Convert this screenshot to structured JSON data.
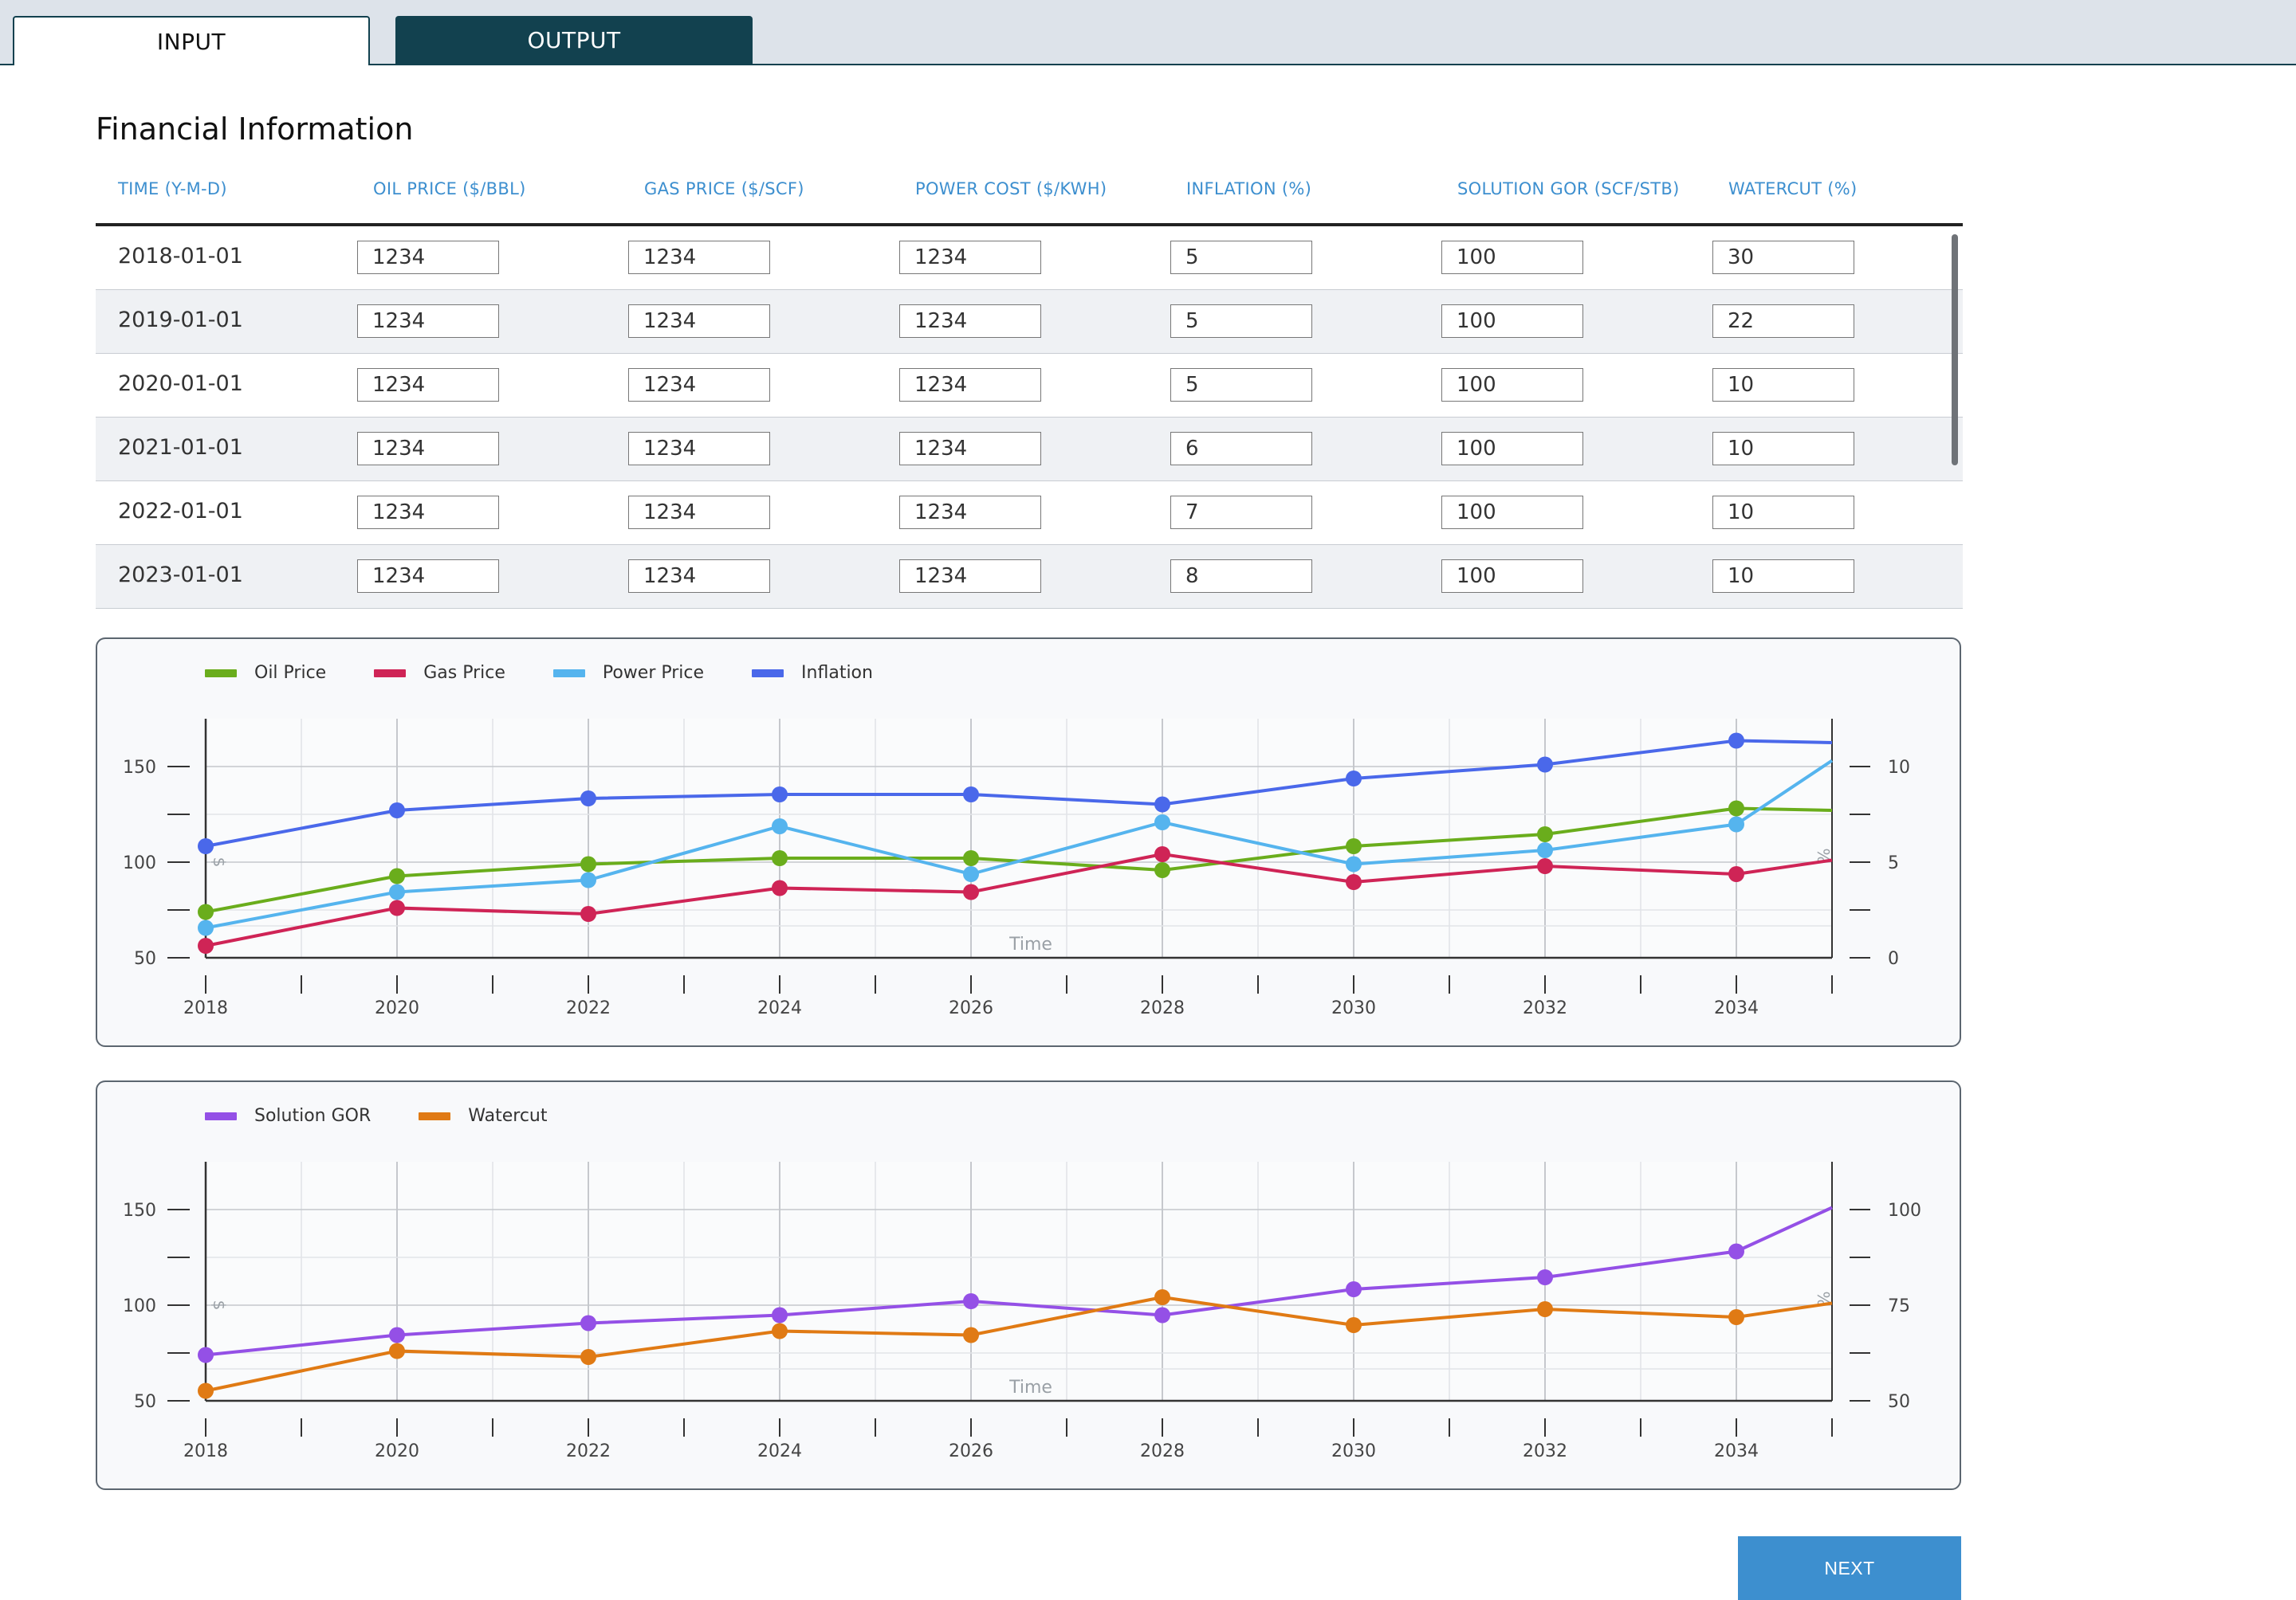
{
  "tabs": {
    "input_label": "INPUT",
    "output_label": "OUTPUT"
  },
  "page_title": "Financial Information",
  "table": {
    "headers": [
      "TIME (Y-M-D)",
      "OIL PRICE ($/BBL)",
      "GAS PRICE ($/SCF)",
      "POWER COST ($/KWH)",
      "INFLATION (%)",
      "SOLUTION GOR (SCF/STB)",
      "WATERCUT (%)"
    ],
    "rows": [
      {
        "date": "2018-01-01",
        "oil": "1234",
        "gas": "1234",
        "power": "1234",
        "inflation": "5",
        "gor": "100",
        "watercut": "30"
      },
      {
        "date": "2019-01-01",
        "oil": "1234",
        "gas": "1234",
        "power": "1234",
        "inflation": "5",
        "gor": "100",
        "watercut": "22"
      },
      {
        "date": "2020-01-01",
        "oil": "1234",
        "gas": "1234",
        "power": "1234",
        "inflation": "5",
        "gor": "100",
        "watercut": "10"
      },
      {
        "date": "2021-01-01",
        "oil": "1234",
        "gas": "1234",
        "power": "1234",
        "inflation": "6",
        "gor": "100",
        "watercut": "10"
      },
      {
        "date": "2022-01-01",
        "oil": "1234",
        "gas": "1234",
        "power": "1234",
        "inflation": "7",
        "gor": "100",
        "watercut": "10"
      },
      {
        "date": "2023-01-01",
        "oil": "1234",
        "gas": "1234",
        "power": "1234",
        "inflation": "8",
        "gor": "100",
        "watercut": "10"
      }
    ]
  },
  "chart_data": [
    {
      "type": "line",
      "xlabel": "Time",
      "ylabel_left": "$",
      "ylabel_right": "%",
      "x": [
        2018,
        2020,
        2022,
        2024,
        2026,
        2028,
        2030,
        2032,
        2034
      ],
      "x_tick_labels": [
        "2018",
        "2020",
        "2022",
        "2024",
        "2026",
        "2028",
        "2030",
        "2032",
        "2034"
      ],
      "xlim": [
        2018,
        2035
      ],
      "ylim_left": [
        50,
        170
      ],
      "ylim_right": [
        0,
        12
      ],
      "yticks_left": [
        "150",
        "100",
        "50"
      ],
      "yticks_right": [
        "10",
        "5",
        "0"
      ],
      "grid": true,
      "legend_position": "top-left",
      "series": [
        {
          "name": "Oil Price",
          "color": "#6aad1c",
          "axis": "left",
          "values": [
            73,
            91,
            97,
            100,
            100,
            94,
            106,
            112,
            125
          ],
          "end_value": 124
        },
        {
          "name": "Gas Price",
          "color": "#cf2456",
          "axis": "left",
          "values": [
            56,
            75,
            72,
            85,
            83,
            102,
            88,
            96,
            92
          ],
          "end_value": 99
        },
        {
          "name": "Power Price",
          "color": "#55b4ee",
          "axis": "left",
          "values": [
            65,
            83,
            89,
            116,
            92,
            118,
            97,
            104,
            117
          ],
          "end_value": 149
        },
        {
          "name": "Inflation",
          "color": "#4a68ea",
          "axis": "right",
          "values": [
            5.6,
            7.4,
            8.0,
            8.2,
            8.2,
            7.7,
            9.0,
            9.7,
            10.9
          ],
          "end_value": 10.8
        }
      ]
    },
    {
      "type": "line",
      "xlabel": "Time",
      "ylabel_left": "$",
      "ylabel_right": "%",
      "x": [
        2018,
        2020,
        2022,
        2024,
        2026,
        2028,
        2030,
        2032,
        2034
      ],
      "x_tick_labels": [
        "2018",
        "2020",
        "2022",
        "2024",
        "2026",
        "2028",
        "2030",
        "2032",
        "2034"
      ],
      "xlim": [
        2018,
        2035
      ],
      "ylim_left": [
        50,
        170
      ],
      "ylim_right": [
        50,
        110
      ],
      "yticks_left": [
        "150",
        "100",
        "50"
      ],
      "yticks_right": [
        "100",
        "75",
        "50"
      ],
      "grid": true,
      "legend_position": "top-left",
      "series": [
        {
          "name": "Solution GOR",
          "color": "#9450e6",
          "axis": "left",
          "values": [
            73,
            83,
            89,
            93,
            100,
            93,
            106,
            112,
            125
          ],
          "end_value": 147
        },
        {
          "name": "Watercut",
          "color": "#e07a14",
          "axis": "left",
          "values": [
            55,
            75,
            72,
            85,
            83,
            102,
            88,
            96,
            92
          ],
          "end_value": 99
        }
      ]
    }
  ],
  "next_button_label": "NEXT"
}
